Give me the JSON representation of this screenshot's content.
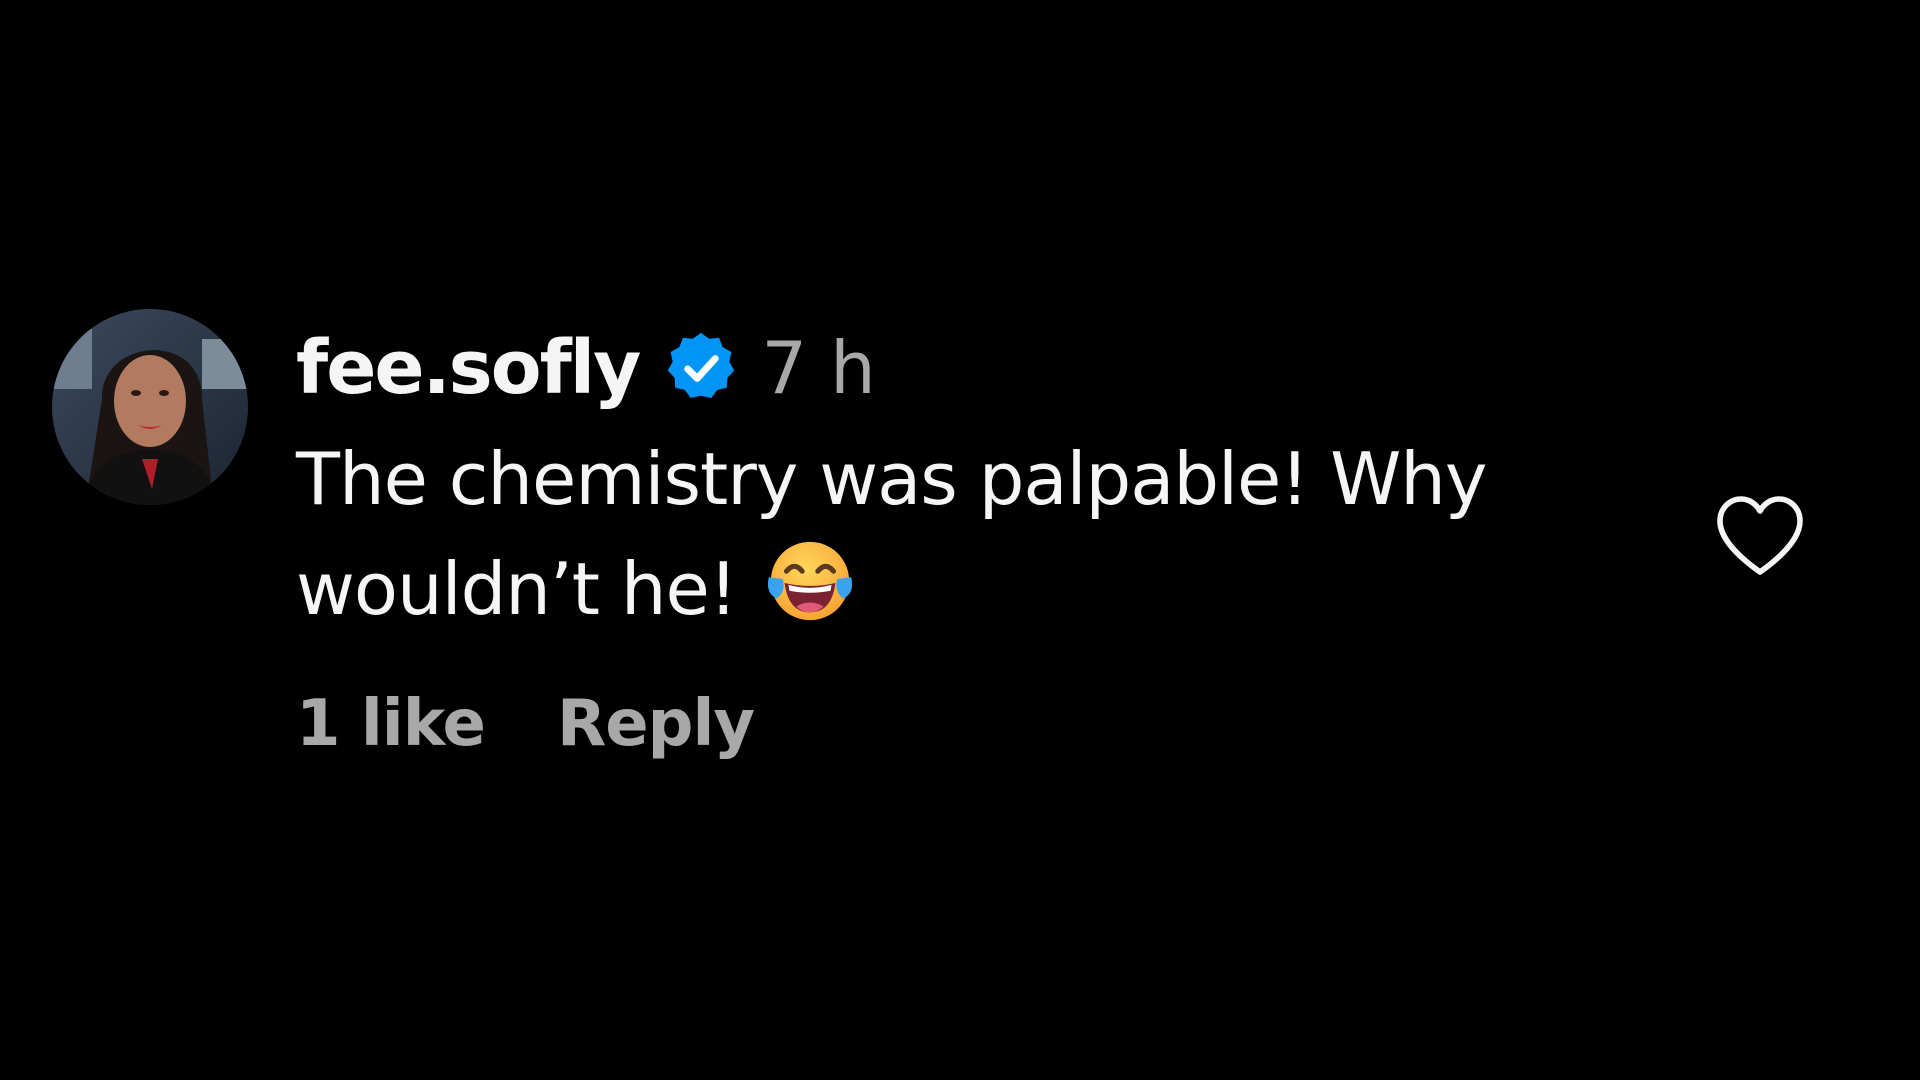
{
  "comment": {
    "username": "fee.sofly",
    "verified": true,
    "timestamp": "7 h",
    "text_line1": "The chemistry was palpable! Why",
    "text_line2": "wouldn’t he!",
    "emoji_icon": "face-with-tears-of-joy-icon",
    "likes_label": "1 like",
    "reply_label": "Reply",
    "like_icon": "heart-outline-icon"
  },
  "colors": {
    "background": "#000000",
    "primary_text": "#f5f5f5",
    "secondary_text": "#a8a8a8",
    "verified_badge": "#0095f6"
  }
}
